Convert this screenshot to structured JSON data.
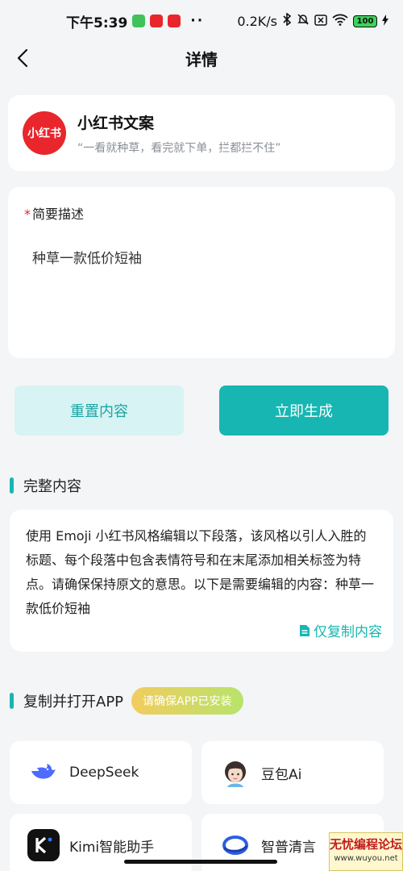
{
  "status_bar": {
    "time": "下午5:39",
    "network_speed": "0.2K/s",
    "battery": "100",
    "dots": "··"
  },
  "header": {
    "title": "详情"
  },
  "app_card": {
    "logo_text": "小红书",
    "name": "小红书文案",
    "slogan": "“一看就种草，看完就下单，拦都拦不住”"
  },
  "form": {
    "required_mark": "*",
    "label": "简要描述",
    "value": "种草一款低价短袖"
  },
  "buttons": {
    "reset": "重置内容",
    "generate": "立即生成"
  },
  "full_content": {
    "section_title": "完整内容",
    "text": "使用 Emoji 小红书风格编辑以下段落，该风格以引人入胜的标题、每个段落中包含表情符号和在末尾添加相关标签为特点。请确保保持原文的意思。以下是需要编辑的内容：种草一款低价短袖",
    "copy_label": "仅复制内容"
  },
  "open_app": {
    "section_title": "复制并打开APP",
    "badge": "请确保APP已安装",
    "apps": [
      {
        "label": "DeepSeek",
        "icon": "deepseek-whale-icon"
      },
      {
        "label": "豆包Ai",
        "icon": "doubao-avatar-icon"
      },
      {
        "label": "Kimi智能助手",
        "icon": "kimi-icon"
      },
      {
        "label": "智普清言",
        "icon": "zhipu-icon"
      }
    ]
  },
  "watermark": {
    "title": "无忧编程论坛",
    "url": "www.wuyou.net"
  },
  "colors": {
    "accent": "#17b6b2",
    "brand_red": "#e8262c",
    "background": "#f3f5f7"
  }
}
